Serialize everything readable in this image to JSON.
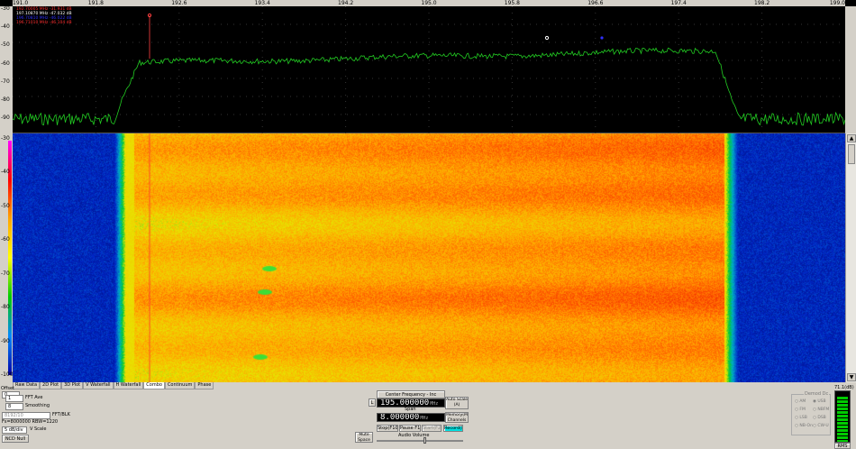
{
  "spectrum": {
    "freq_ticks": [
      "191.0",
      "191.8",
      "192.6",
      "193.4",
      "194.2",
      "195.0",
      "195.8",
      "196.6",
      "197.4",
      "198.2",
      "199.0"
    ],
    "db_ticks": [
      "-30",
      "-40",
      "-50",
      "-60",
      "-70",
      "-80",
      "-90"
    ],
    "markers": [
      {
        "text": "192.70005 MHz  -31.931 dB",
        "color": "#ff3030"
      },
      {
        "text": "197.10870 MHz  -47.032 dB",
        "color": "#ffffff"
      },
      {
        "text": "196.70810 MHz  -46.022 dB",
        "color": "#3030ff"
      },
      {
        "text": "196.71010 MHz  -46.104 dB",
        "color": "#ff3030"
      }
    ],
    "trace_color": "#22cc22"
  },
  "waterfall": {
    "db_ticks": [
      "-30",
      "-40",
      "-50",
      "-60",
      "-70",
      "-80",
      "-90",
      "-100"
    ]
  },
  "tabs": [
    {
      "label": "Raw Data",
      "active": false
    },
    {
      "label": "2D Plot",
      "active": false
    },
    {
      "label": "3D Plot",
      "active": false
    },
    {
      "label": "V Waterfall",
      "active": false
    },
    {
      "label": "H Waterfall",
      "active": false
    },
    {
      "label": "Combo",
      "active": true
    },
    {
      "label": "Continuum",
      "active": false
    },
    {
      "label": "Phase",
      "active": false
    }
  ],
  "controls": {
    "offset_label": "Offset",
    "offset_value": "0",
    "fft_ave_value": "1",
    "fft_ave_label": "FFT Ave",
    "smoothing_value": "8",
    "smoothing_label": "Smoothing",
    "fft_blk_value": "8192/10",
    "fft_blk_label": "FFT/BLK",
    "fs_line": "Fs=8000000 RBW=1220",
    "vscale_value": "5 dB/div",
    "vscale_label": "V Scale",
    "ncd_button": "NCD Null",
    "cf_button": "Center Frequency - Inc",
    "l_button": "L",
    "center_freq": "195.000000",
    "center_unit": "MHz",
    "span_label": "Span",
    "span_value": "8.000000",
    "span_unit": "MHz",
    "auto_scale": "Auto Scale (A)",
    "memory_button": "Memory(M) Channels",
    "mute_button": "Mute Space Bar",
    "stop_button": "Stop(F10)",
    "pause_button": "Pause F11",
    "start_button": "Start(F2)",
    "record_button": "Record(F3)",
    "audio_volume": "Audio Volume",
    "detect_group": "Demod Dc",
    "modes": [
      "AM",
      "FM",
      "LSB",
      "NB-On"
    ],
    "modes2": [
      "USB",
      "NBFM",
      "DSB",
      "CW-U"
    ],
    "right_value": "71.1(dB)",
    "rms_label": "RMS"
  }
}
